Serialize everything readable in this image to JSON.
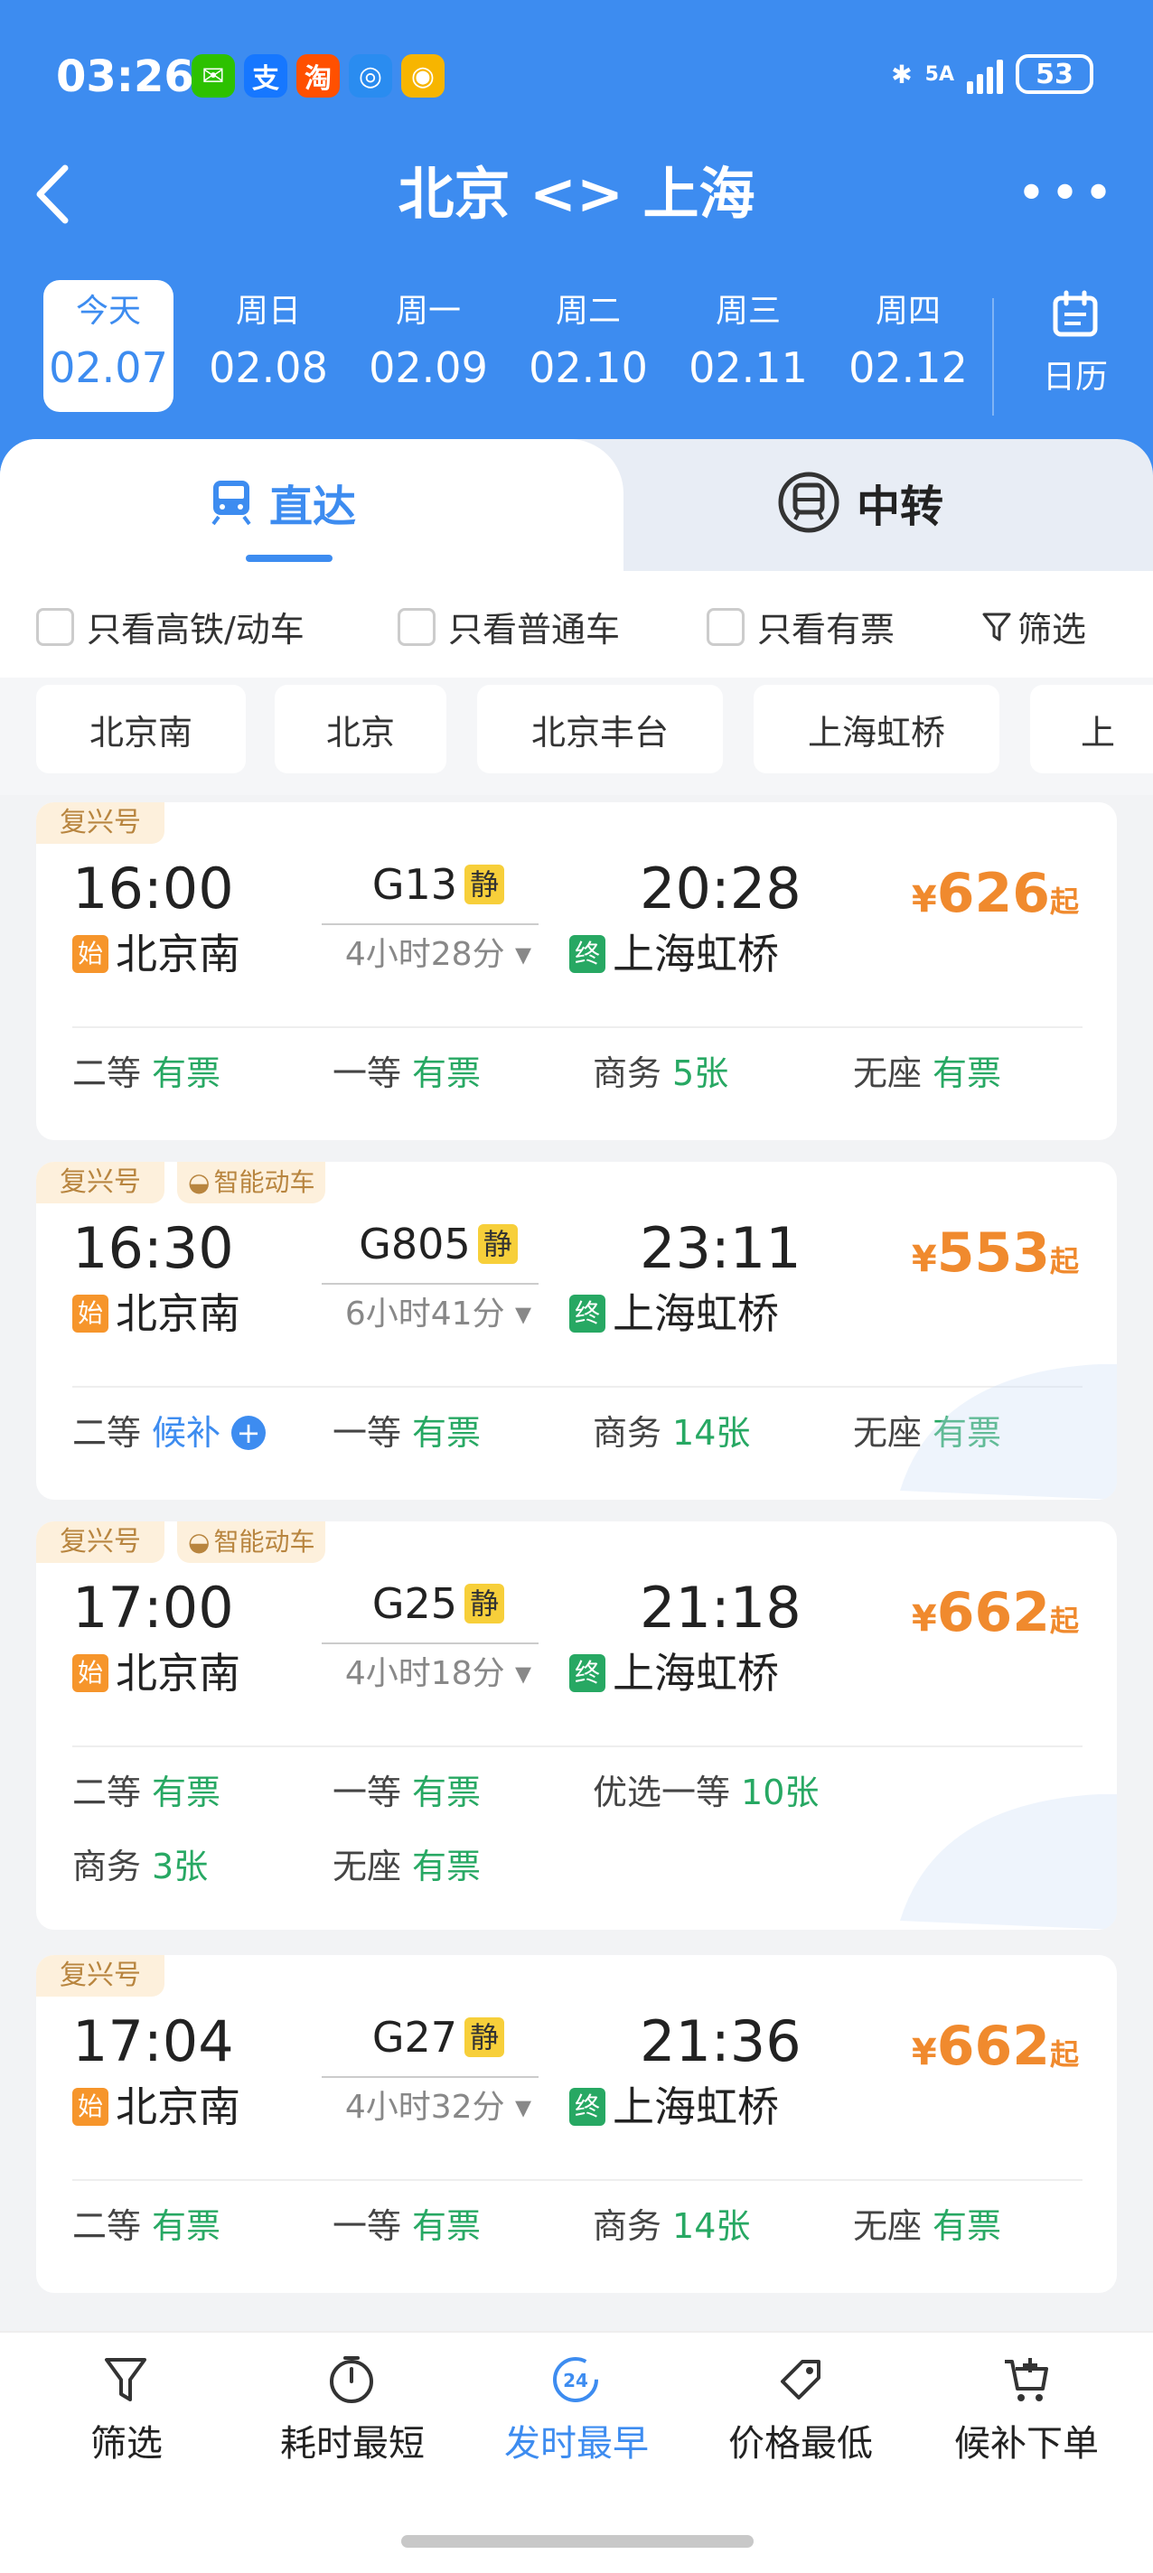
{
  "status_bar": {
    "time": "03:26",
    "apps": [
      {
        "name": "wechat-icon",
        "glyph": "✉",
        "color": "#2dc100"
      },
      {
        "name": "alipay-icon",
        "glyph": "支",
        "color": "#1677ff"
      },
      {
        "name": "taobao-icon",
        "glyph": "淘",
        "color": "#ff5000"
      },
      {
        "name": "browser-icon",
        "glyph": "◎",
        "color": "#2a8cf0"
      },
      {
        "name": "tencent-news-icon",
        "glyph": "◉",
        "color": "#f7b500"
      }
    ],
    "network": "5A",
    "battery": "53"
  },
  "header": {
    "title": "北京 <> 上海"
  },
  "dates": [
    {
      "weekday": "今天",
      "date": "02.07",
      "selected": true
    },
    {
      "weekday": "周日",
      "date": "02.08",
      "selected": false
    },
    {
      "weekday": "周一",
      "date": "02.09",
      "selected": false
    },
    {
      "weekday": "周二",
      "date": "02.10",
      "selected": false
    },
    {
      "weekday": "周三",
      "date": "02.11",
      "selected": false
    },
    {
      "weekday": "周四",
      "date": "02.12",
      "selected": false
    }
  ],
  "calendar_label": "日历",
  "tabs": {
    "direct": "直达",
    "transfer": "中转"
  },
  "filters": {
    "high_speed": "只看高铁/动车",
    "normal": "只看普通车",
    "available": "只看有票",
    "filter": "筛选"
  },
  "stations": [
    "北京南",
    "北京",
    "北京丰台",
    "上海虹桥",
    "上"
  ],
  "trains": [
    {
      "tags": [
        "复兴号"
      ],
      "dep_time": "16:00",
      "train_no": "G13",
      "quiet": "静",
      "arr_time": "20:28",
      "duration": "4小时28分",
      "dep_station": "北京南",
      "arr_station": "上海虹桥",
      "start_badge": "始",
      "end_badge": "终",
      "price": "626",
      "price_suffix": "起",
      "seats": [
        {
          "class": "二等",
          "status": "有票"
        },
        {
          "class": "一等",
          "status": "有票"
        },
        {
          "class": "商务",
          "status": "5张"
        },
        {
          "class": "无座",
          "status": "有票"
        }
      ]
    },
    {
      "tags": [
        "复兴号",
        "智能动车"
      ],
      "dep_time": "16:30",
      "train_no": "G805",
      "quiet": "静",
      "arr_time": "23:11",
      "duration": "6小时41分",
      "dep_station": "北京南",
      "arr_station": "上海虹桥",
      "start_badge": "始",
      "end_badge": "终",
      "price": "553",
      "price_suffix": "起",
      "seats": [
        {
          "class": "二等",
          "status": "候补"
        },
        {
          "class": "一等",
          "status": "有票"
        },
        {
          "class": "商务",
          "status": "14张"
        },
        {
          "class": "无座",
          "status": "有票"
        }
      ]
    },
    {
      "tags": [
        "复兴号",
        "智能动车"
      ],
      "dep_time": "17:00",
      "train_no": "G25",
      "quiet": "静",
      "arr_time": "21:18",
      "duration": "4小时18分",
      "dep_station": "北京南",
      "arr_station": "上海虹桥",
      "start_badge": "始",
      "end_badge": "终",
      "price": "662",
      "price_suffix": "起",
      "seats": [
        {
          "class": "二等",
          "status": "有票"
        },
        {
          "class": "一等",
          "status": "有票"
        },
        {
          "class": "优选一等",
          "status": "10张"
        },
        {
          "class": "商务",
          "status": "3张"
        },
        {
          "class": "无座",
          "status": "有票"
        }
      ]
    },
    {
      "tags": [
        "复兴号"
      ],
      "dep_time": "17:04",
      "train_no": "G27",
      "quiet": "静",
      "arr_time": "21:36",
      "duration": "4小时32分",
      "dep_station": "北京南",
      "arr_station": "上海虹桥",
      "start_badge": "始",
      "end_badge": "终",
      "price": "662",
      "price_suffix": "起",
      "seats": [
        {
          "class": "二等",
          "status": "有票"
        },
        {
          "class": "一等",
          "status": "有票"
        },
        {
          "class": "商务",
          "status": "14张"
        },
        {
          "class": "无座",
          "status": "有票"
        }
      ]
    }
  ],
  "bottom_nav": [
    {
      "label": "筛选",
      "icon": "filter-icon",
      "selected": false
    },
    {
      "label": "耗时最短",
      "icon": "stopwatch-icon",
      "selected": false
    },
    {
      "label": "发时最早",
      "icon": "clock-24-icon",
      "badge": "24",
      "selected": true
    },
    {
      "label": "价格最低",
      "icon": "price-tag-icon",
      "selected": false
    },
    {
      "label": "候补下单",
      "icon": "cart-add-icon",
      "selected": false
    }
  ],
  "colors": {
    "primary": "#3d8cf0",
    "price": "#f08a2e",
    "available": "#27a863",
    "tag_bg": "#fdf0dc"
  }
}
